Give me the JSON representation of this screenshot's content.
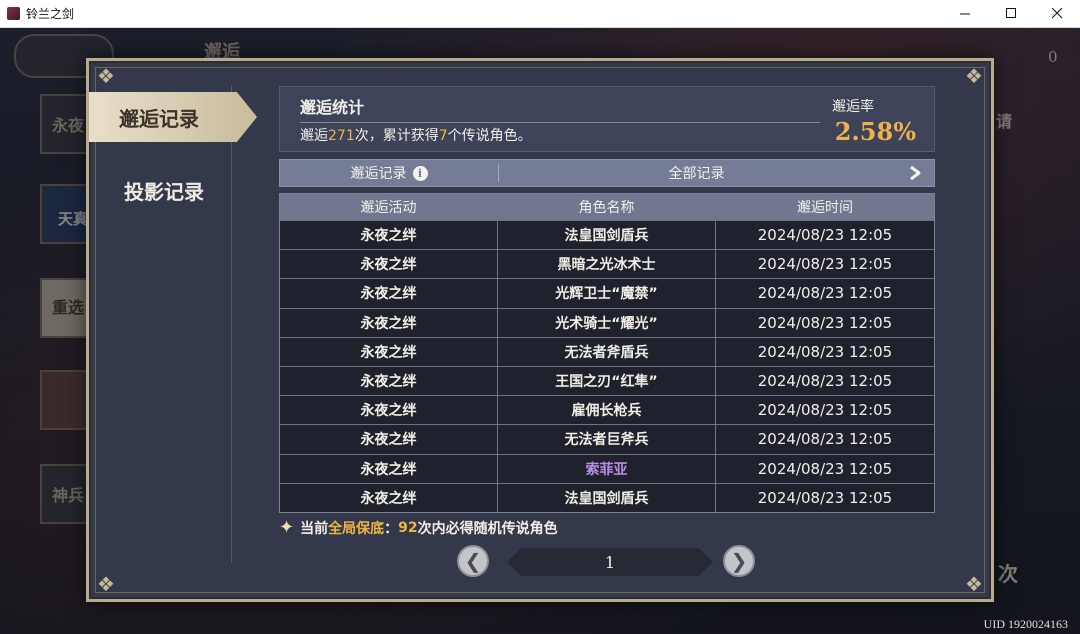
{
  "window": {
    "title": "铃兰之剑"
  },
  "background": {
    "uid": "UID 1920024163",
    "peek_texts": [
      "邂逅",
      "永夜",
      "天真",
      "重选",
      "神兵",
      "请",
      "次",
      "0"
    ]
  },
  "tabs": [
    {
      "label": "邂逅记录",
      "active": true
    },
    {
      "label": "投影记录",
      "active": false
    }
  ],
  "stats": {
    "title": "邂逅统计",
    "summary_prefix": "邂逅",
    "pull_count": "271",
    "summary_mid": "次，累计获得",
    "legend_count": "7",
    "summary_suffix": "个传说角色。",
    "rate_label": "邂逅率",
    "rate_value": "2.58%"
  },
  "filter": {
    "left_label": "邂逅记录",
    "info_icon": "i",
    "selected": "全部记录",
    "chevron": "❯"
  },
  "table": {
    "headers": [
      "邂逅活动",
      "角色名称",
      "邂逅时间"
    ],
    "rows": [
      {
        "event": "永夜之绊",
        "name": "法皇国剑盾兵",
        "time": "2024/08/23 12:05",
        "rare": false
      },
      {
        "event": "永夜之绊",
        "name": "黑暗之光冰术士",
        "time": "2024/08/23 12:05",
        "rare": false
      },
      {
        "event": "永夜之绊",
        "name": "光辉卫士“魔禁”",
        "time": "2024/08/23 12:05",
        "rare": false
      },
      {
        "event": "永夜之绊",
        "name": "光术骑士“耀光”",
        "time": "2024/08/23 12:05",
        "rare": false
      },
      {
        "event": "永夜之绊",
        "name": "无法者斧盾兵",
        "time": "2024/08/23 12:05",
        "rare": false
      },
      {
        "event": "永夜之绊",
        "name": "王国之刃“红隼”",
        "time": "2024/08/23 12:05",
        "rare": false
      },
      {
        "event": "永夜之绊",
        "name": "雇佣长枪兵",
        "time": "2024/08/23 12:05",
        "rare": false
      },
      {
        "event": "永夜之绊",
        "name": "无法者巨斧兵",
        "time": "2024/08/23 12:05",
        "rare": false
      },
      {
        "event": "永夜之绊",
        "name": "索菲亚",
        "time": "2024/08/23 12:05",
        "rare": true
      },
      {
        "event": "永夜之绊",
        "name": "法皇国剑盾兵",
        "time": "2024/08/23 12:05",
        "rare": false
      }
    ]
  },
  "guarantee": {
    "prefix": "当前",
    "highlight": "全局保底",
    "colon": "：",
    "count": "92",
    "suffix": "次内必得随机传说角色"
  },
  "pagination": {
    "prev": "❮",
    "page": "1",
    "next": "❯"
  },
  "colors": {
    "accent": "#f0b444",
    "rare_name": "#b98ee8",
    "panel": "#33384a",
    "border": "#b8ab8b"
  }
}
